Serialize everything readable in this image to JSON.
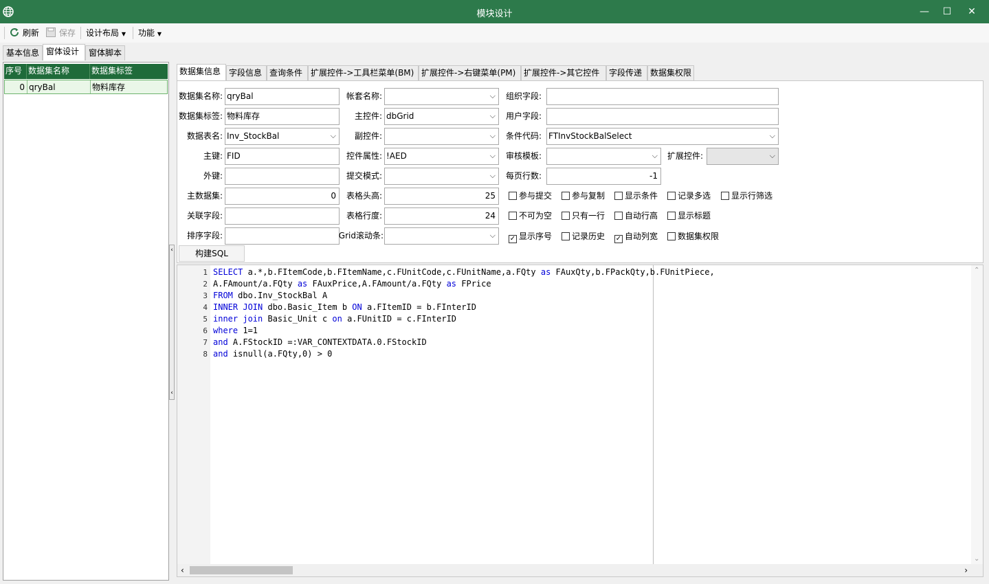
{
  "window": {
    "title": "模块设计",
    "minimize": "—",
    "maximize": "☐",
    "close": "✕"
  },
  "toolbar": {
    "refresh": "刷新",
    "save": "保存",
    "layout": "设计布局",
    "function": "功能"
  },
  "main_tabs": [
    "基本信息",
    "窗体设计",
    "窗体脚本"
  ],
  "dataset_grid": {
    "headers": [
      "序号",
      "数据集名称",
      "数据集标签"
    ],
    "rows": [
      {
        "index": "0",
        "name": "qryBal",
        "label": "物料库存"
      }
    ]
  },
  "inner_tabs": [
    "数据集信息",
    "字段信息",
    "查询条件",
    "扩展控件->工具栏菜单(BM)",
    "扩展控件->右键菜单(PM)",
    "扩展控件->其它控件",
    "字段传递",
    "数据集权限"
  ],
  "form": {
    "labels": {
      "dataset_name": "数据集名称:",
      "dataset_label": "数据集标签:",
      "table_name": "数据表名:",
      "primary_key": "主键:",
      "foreign_key": "外键:",
      "master_dataset": "主数据集:",
      "link_field": "关联字段:",
      "sort_field": "排序字段:",
      "account_name": "帐套名称:",
      "main_control": "主控件:",
      "sub_control": "副控件:",
      "control_props": "控件属性:",
      "submit_mode": "提交模式:",
      "header_height": "表格头高:",
      "row_height": "表格行度:",
      "grid_scroll": "Grid滚动条:",
      "org_field": "组织字段:",
      "user_field": "用户字段:",
      "condition_code": "条件代码:",
      "audit_template": "审核模板:",
      "page_rows": "每页行数:",
      "ext_control": "扩展控件:"
    },
    "values": {
      "dataset_name": "qryBal",
      "dataset_label": "物料库存",
      "table_name": "Inv_StockBal",
      "primary_key": "FID",
      "foreign_key": "",
      "master_dataset": "0",
      "link_field": "",
      "sort_field": "",
      "account_name": "",
      "main_control": "dbGrid",
      "sub_control": "",
      "control_props": "!AED",
      "submit_mode": "",
      "header_height": "25",
      "row_height": "24",
      "grid_scroll": "",
      "org_field": "",
      "user_field": "",
      "condition_code": "FTInvStockBalSelect",
      "audit_template": "",
      "page_rows": "-1",
      "ext_control": ""
    },
    "checkboxes": [
      {
        "label": "参与提交",
        "checked": false
      },
      {
        "label": "参与复制",
        "checked": false
      },
      {
        "label": "显示条件",
        "checked": false
      },
      {
        "label": "记录多选",
        "checked": false
      },
      {
        "label": "显示行筛选",
        "checked": false
      },
      {
        "label": "不可为空",
        "checked": false
      },
      {
        "label": "只有一行",
        "checked": false
      },
      {
        "label": "自动行高",
        "checked": false
      },
      {
        "label": "显示标题",
        "checked": false
      },
      {
        "label": "显示序号",
        "checked": true
      },
      {
        "label": "记录历史",
        "checked": false
      },
      {
        "label": "自动列宽",
        "checked": true
      },
      {
        "label": "数据集权限",
        "checked": false
      }
    ],
    "build_sql": "构建SQL"
  },
  "sql_lines": [
    [
      {
        "k": "SELECT"
      },
      {
        "t": " a.*,b.FItemCode,b.FItemName,c.FUnitCode,c.FUnitName,a.FQty "
      },
      {
        "k": "as"
      },
      {
        "t": " FAuxQty,b.FPackQty,b.FUnitPiece,"
      }
    ],
    [
      {
        "t": "A.FAmount/a.FQty "
      },
      {
        "k": "as"
      },
      {
        "t": " FAuxPrice,A.FAmount/a.FQty "
      },
      {
        "k": "as"
      },
      {
        "t": " FPrice"
      }
    ],
    [
      {
        "k": "FROM"
      },
      {
        "t": " dbo.Inv_StockBal A"
      }
    ],
    [
      {
        "k": "INNER JOIN"
      },
      {
        "t": " dbo.Basic_Item b "
      },
      {
        "k": "ON"
      },
      {
        "t": " a.FItemID = b.FInterID"
      }
    ],
    [
      {
        "k": "inner join"
      },
      {
        "t": " Basic_Unit c "
      },
      {
        "k": "on"
      },
      {
        "t": " a.FUnitID = c.FInterID"
      }
    ],
    [
      {
        "k": "where"
      },
      {
        "t": " 1=1"
      }
    ],
    [
      {
        "k": "and"
      },
      {
        "t": " A.FStockID =:VAR_CONTEXTDATA.0.FStockID"
      }
    ],
    [
      {
        "k": "and"
      },
      {
        "t": " isnull(a.FQty,0) > 0"
      }
    ]
  ],
  "colors": {
    "title_bar": "#2d7a4b",
    "grid_header": "#1f6b3a",
    "keyword": "#0000d8"
  }
}
